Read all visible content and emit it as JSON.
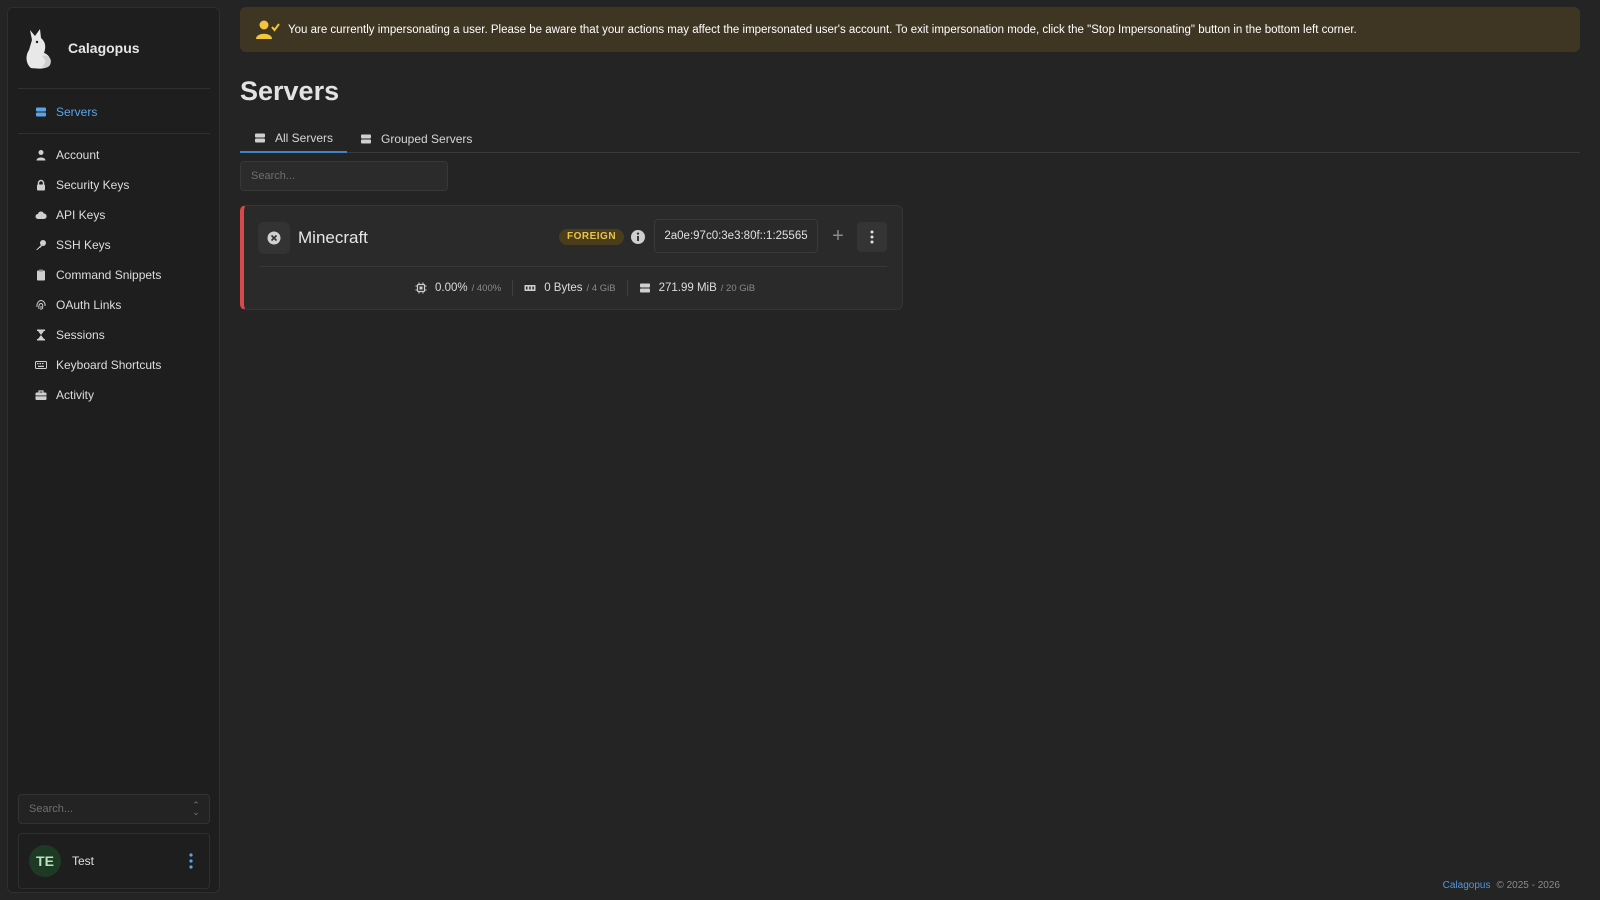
{
  "brand": {
    "name": "Calagopus"
  },
  "sidebar": {
    "items": [
      {
        "label": "Servers",
        "icon": "servers-icon",
        "active": true
      },
      {
        "label": "Account",
        "icon": "user-icon"
      },
      {
        "label": "Security Keys",
        "icon": "lock-icon"
      },
      {
        "label": "API Keys",
        "icon": "cloud-icon"
      },
      {
        "label": "SSH Keys",
        "icon": "key-icon"
      },
      {
        "label": "Command Snippets",
        "icon": "clipboard-icon"
      },
      {
        "label": "OAuth Links",
        "icon": "fingerprint-icon"
      },
      {
        "label": "Sessions",
        "icon": "hourglass-icon"
      },
      {
        "label": "Keyboard Shortcuts",
        "icon": "keyboard-icon"
      },
      {
        "label": "Activity",
        "icon": "briefcase-icon"
      }
    ],
    "search_placeholder": "Search...",
    "user": {
      "initials": "TE",
      "name": "Test"
    }
  },
  "banner": {
    "text": "You are currently impersonating a user. Please be aware that your actions may affect the impersonated user's account. To exit impersonation mode, click the \"Stop Impersonating\" button in the bottom left corner."
  },
  "page": {
    "title": "Servers",
    "tabs": [
      {
        "label": "All Servers",
        "active": true
      },
      {
        "label": "Grouped Servers",
        "active": false
      }
    ],
    "search_placeholder": "Search..."
  },
  "server": {
    "name": "Minecraft",
    "badge": "FOREIGN",
    "address": "2a0e:97c0:3e3:80f::1:25565",
    "status_color": "#d84a4a",
    "cpu": {
      "value": "0.00%",
      "limit": "/ 400%"
    },
    "memory": {
      "value": "0 Bytes",
      "limit": "/ 4 GiB"
    },
    "disk": {
      "value": "271.99 MiB",
      "limit": "/ 20 GiB"
    }
  },
  "footer": {
    "link": "Calagopus",
    "text": "© 2025 - 2026"
  },
  "colors": {
    "accent": "#5aa4e8",
    "banner_bg": "#3e3522",
    "badge_text": "#e9c34b"
  }
}
